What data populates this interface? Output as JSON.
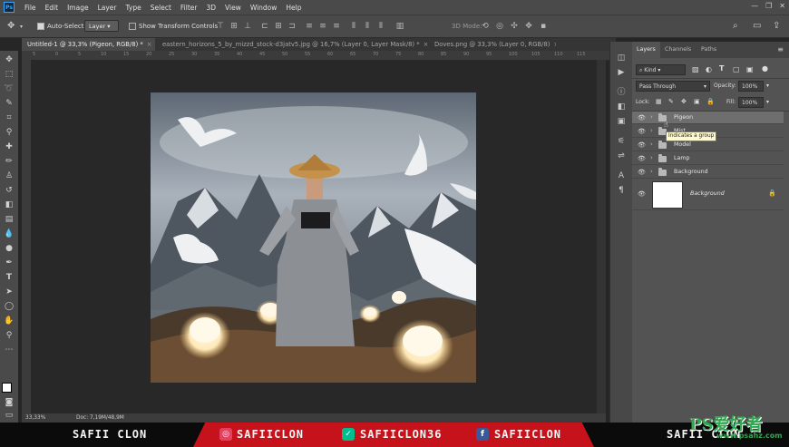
{
  "app": {
    "logo": "Ps",
    "menu": [
      "File",
      "Edit",
      "Image",
      "Layer",
      "Type",
      "Select",
      "Filter",
      "3D",
      "View",
      "Window",
      "Help"
    ],
    "window_controls": [
      "—",
      "❐",
      "✕"
    ]
  },
  "options": {
    "auto_select_label": "Auto-Select:",
    "auto_select_value": "Layer",
    "show_transform_label": "Show Transform Controls",
    "mode_3d_label": "3D Mode:"
  },
  "tabs": [
    {
      "label": "Untitled-1 @ 33,3% (Pigeon, RGB/8) *",
      "active": true
    },
    {
      "label": "eastern_horizons_5_by_mizzd_stock-d3jatv5.jpg @ 16,7% (Layer 0, Layer Mask/8) *",
      "active": false
    },
    {
      "label": "Doves.png @ 33,3% (Layer 0, RGB/8)",
      "active": false
    }
  ],
  "ruler_numbers": [
    "5",
    "0",
    "5",
    "10",
    "15",
    "20",
    "25",
    "30",
    "35",
    "40",
    "45",
    "50",
    "55",
    "60",
    "65",
    "70",
    "75",
    "80",
    "85",
    "90",
    "95",
    "100",
    "105",
    "110",
    "115"
  ],
  "status": {
    "zoom": "33,33%",
    "doc": "Doc: 7,19M/48,9M"
  },
  "panel": {
    "tabs": [
      "Layers",
      "Channels",
      "Paths"
    ],
    "kind_label": "Kind",
    "blend_mode": "Pass Through",
    "opacity_label": "Opacity:",
    "opacity_value": "100%",
    "lock_label": "Lock:",
    "fill_label": "Fill:",
    "fill_value": "100%",
    "layers": [
      {
        "name": "Pigeon",
        "type": "group",
        "selected": true
      },
      {
        "name": "Mist",
        "type": "group",
        "selected": false
      },
      {
        "name": "Model",
        "type": "group",
        "selected": false
      },
      {
        "name": "Lamp",
        "type": "group",
        "selected": false
      },
      {
        "name": "Background",
        "type": "group",
        "selected": false
      }
    ],
    "background_layer": {
      "name": "Background"
    },
    "tooltip": "Indicates a group"
  },
  "banner": {
    "left_name": "SAFII CLON",
    "instagram": "SAFIICLON",
    "vine": "SAFIICLON36",
    "facebook": "SAFIICLON",
    "right_name": "SAFII CLON"
  },
  "watermark": {
    "title": "PS爱好者",
    "url": "www.psahz.com"
  }
}
